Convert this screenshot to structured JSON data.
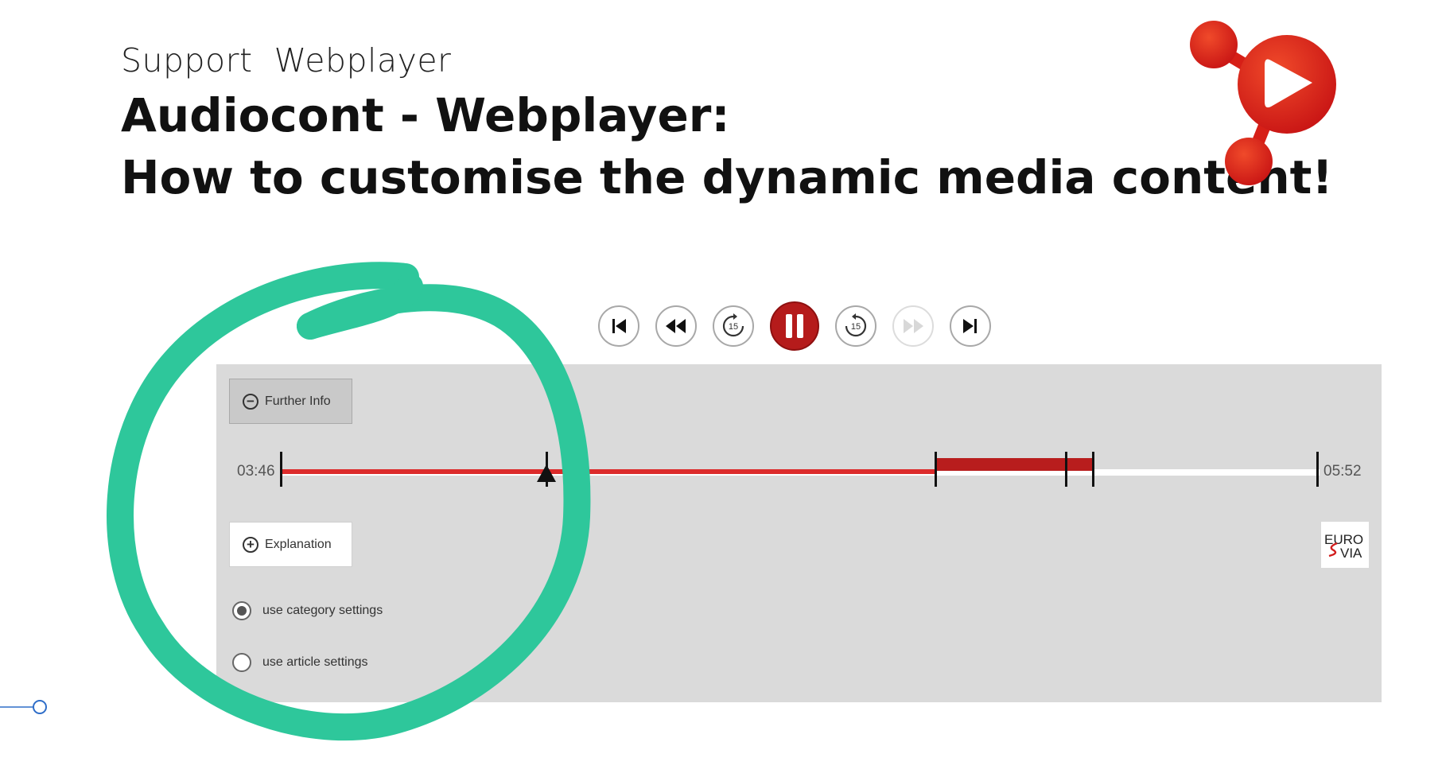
{
  "slide": {
    "kicker": "Support  Webplayer",
    "title_line1": "Audiocont - Webplayer:",
    "title_line2": "How to customise the dynamic media content!"
  },
  "colors": {
    "accent_red": "#dc2b2b",
    "segment_red": "#b81d1d",
    "annotation_green": "#2ec79b",
    "panel_gray": "#dadada"
  },
  "player": {
    "controls": [
      {
        "name": "skip-to-start",
        "icon": "skip-back-icon"
      },
      {
        "name": "rewind",
        "icon": "rewind-icon"
      },
      {
        "name": "back-15",
        "icon": "replay-15-icon",
        "label": "15"
      },
      {
        "name": "pause",
        "icon": "pause-icon"
      },
      {
        "name": "forward-15",
        "icon": "forward-15-icon",
        "label": "15"
      },
      {
        "name": "fast-forward",
        "icon": "fast-forward-icon",
        "state": "disabled"
      },
      {
        "name": "skip-to-end",
        "icon": "skip-forward-icon"
      }
    ],
    "further_info_label": "Further Info",
    "explanation_label": "Explanation",
    "time_start": "03:46",
    "time_end": "05:52",
    "progress_fraction": 0.63,
    "radio_options": [
      {
        "label": "use category settings",
        "selected": true
      },
      {
        "label": "use article settings",
        "selected": false
      }
    ],
    "brand_badge": {
      "line1": "EURO",
      "line2": "VIA"
    }
  }
}
